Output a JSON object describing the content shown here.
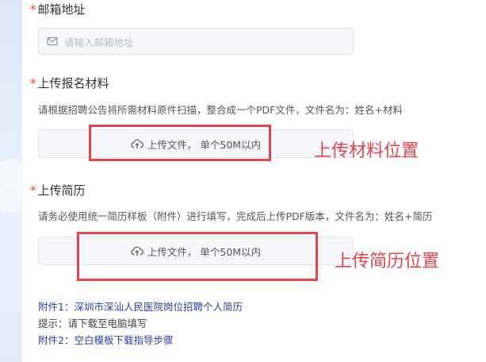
{
  "email": {
    "required_mark": "*",
    "label": "邮箱地址",
    "placeholder": "请输入邮箱地址",
    "icon": "mail-icon"
  },
  "materials": {
    "required_mark": "*",
    "label": "上传报名材料",
    "hint": "请根据招聘公告将所需材料原件扫描，整合成一个PDF文件，文件名为：姓名+材料",
    "upload_label": "上传文件， 单个50M以内",
    "upload_icon": "cloud-upload-icon",
    "annotation": "上传材料位置"
  },
  "resume": {
    "required_mark": "*",
    "label": "上传简历",
    "hint": "请务必使用统一简历样板（附件）进行填写，完成后上传PDF版本，文件名为：姓名+简历",
    "upload_label": "上传文件， 单个50M以内",
    "upload_icon": "cloud-upload-icon",
    "annotation": "上传简历位置"
  },
  "attachments": {
    "attachment1": "附件1：深圳市深汕人民医院岗位招聘个人简历",
    "tip": "提示：请下载至电脑填写",
    "attachment2": "附件2：空白模板下载指导步骤"
  },
  "colors": {
    "annotation_red": "#e8434a",
    "required_red": "#e1443a",
    "link_blue": "#2b3fb0"
  }
}
